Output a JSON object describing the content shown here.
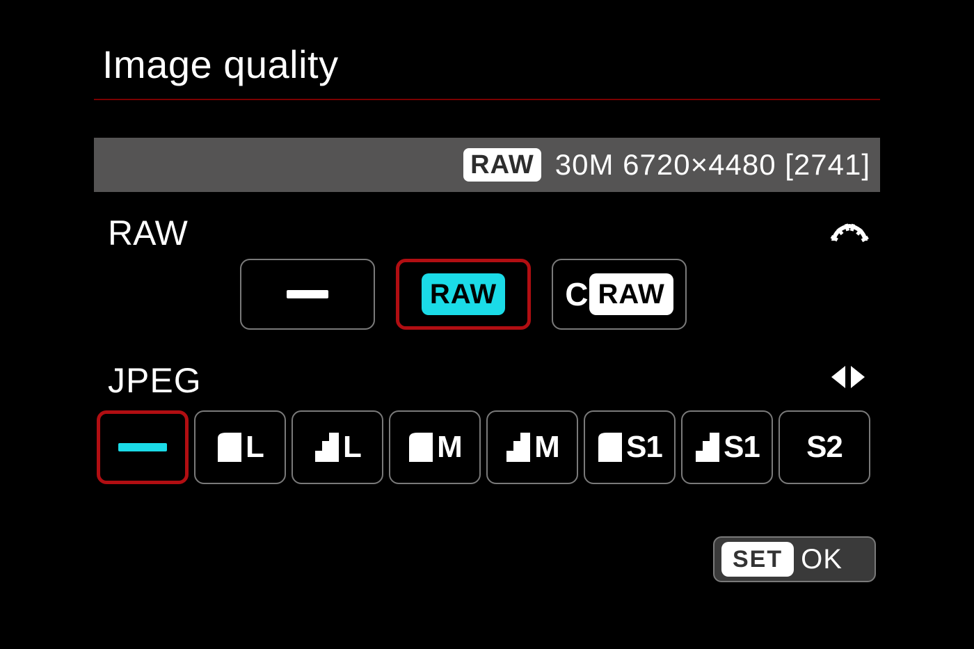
{
  "title": "Image quality",
  "status": {
    "raw_chip": "RAW",
    "info": "30M 6720×4480 [2741]"
  },
  "sections": {
    "raw_label": "RAW",
    "jpeg_label": "JPEG"
  },
  "raw_options": {
    "raw_label": "RAW",
    "craw_c": "C",
    "craw_label": "RAW"
  },
  "jpeg_options": {
    "L": "L",
    "M": "M",
    "S1": "S1",
    "S2": "S2"
  },
  "footer": {
    "set": "SET",
    "ok": "OK"
  }
}
